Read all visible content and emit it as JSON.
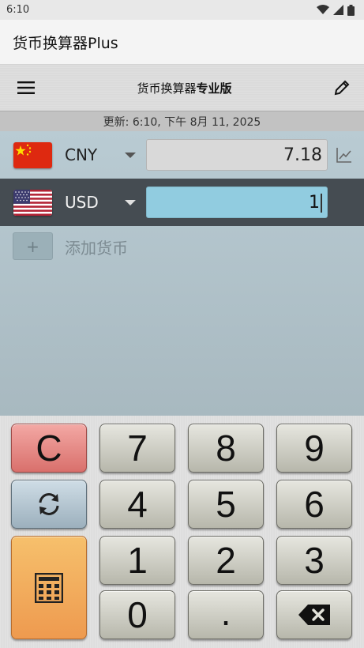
{
  "status_bar": {
    "time": "6:10",
    "icons": [
      "wifi-icon",
      "signal-icon",
      "battery-icon"
    ]
  },
  "app_bar": {
    "title": "货币换算器Plus"
  },
  "toolbar": {
    "title_regular": "货币换算器",
    "title_bold": "专业版",
    "menu_icon": "hamburger-menu-icon",
    "edit_icon": "pencil-icon"
  },
  "update": {
    "text": "更新: 6:10, 下午 8月 11, 2025"
  },
  "currencies": [
    {
      "code": "CNY",
      "flag": "china-flag",
      "amount": "7.18",
      "active": false
    },
    {
      "code": "USD",
      "flag": "us-flag",
      "amount": "1",
      "active": true
    }
  ],
  "add_currency": {
    "button_symbol": "+",
    "label": "添加货币"
  },
  "keypad": {
    "clear": "C",
    "digits": {
      "d0": "0",
      "d1": "1",
      "d2": "2",
      "d3": "3",
      "d4": "4",
      "d5": "5",
      "d6": "6",
      "d7": "7",
      "d8": "8",
      "d9": "9"
    },
    "dot": ".",
    "swap_icon": "refresh-icon",
    "calculator_icon": "calculator-icon",
    "backspace_icon": "backspace-icon"
  },
  "colors": {
    "active_row": "#454c52",
    "active_input": "#91cce0",
    "clear_key": "#e48a86",
    "calc_key": "#f2ac5d",
    "swap_key": "#b6c7d2"
  }
}
